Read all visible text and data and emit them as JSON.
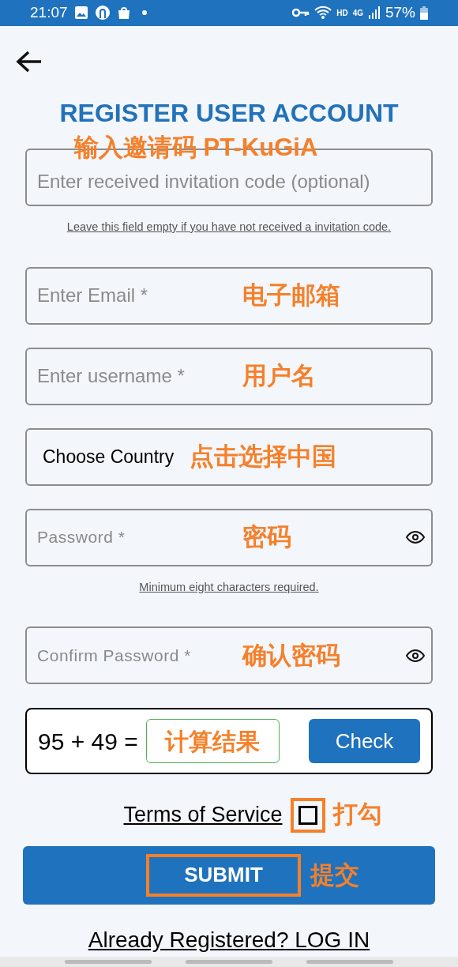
{
  "status_bar": {
    "time": "21:07",
    "hd": "HD",
    "network": "4G",
    "battery": "57%"
  },
  "title": "REGISTER USER ACCOUNT",
  "fields": [
    {
      "kind": "text",
      "placeholder": "Enter received invitation code (optional)",
      "annotation_above": "输入邀请码  PT-KuGiA",
      "hint": "Leave this field empty if you have not received a invitation code."
    },
    {
      "kind": "text",
      "placeholder": "Enter Email *",
      "annotation": "电子邮箱"
    },
    {
      "kind": "text",
      "placeholder": "Enter username *",
      "annotation": "用户名"
    },
    {
      "kind": "select",
      "value": "Choose Country",
      "annotation": "点击选择中国"
    },
    {
      "kind": "password",
      "placeholder": "Password *",
      "annotation": "密码",
      "hint": "Minimum eight characters required."
    },
    {
      "kind": "password",
      "placeholder": "Confirm Password *",
      "annotation": "确认密码"
    }
  ],
  "captcha": {
    "question": "95 + 49 =",
    "annotation": "计算结果",
    "button": "Check"
  },
  "terms": {
    "label": "Terms of Service",
    "checked": false,
    "annotation": "打勾"
  },
  "submit": {
    "label": "SUBMIT",
    "annotation": "提交"
  },
  "login_link": "Already Registered? LOG IN"
}
